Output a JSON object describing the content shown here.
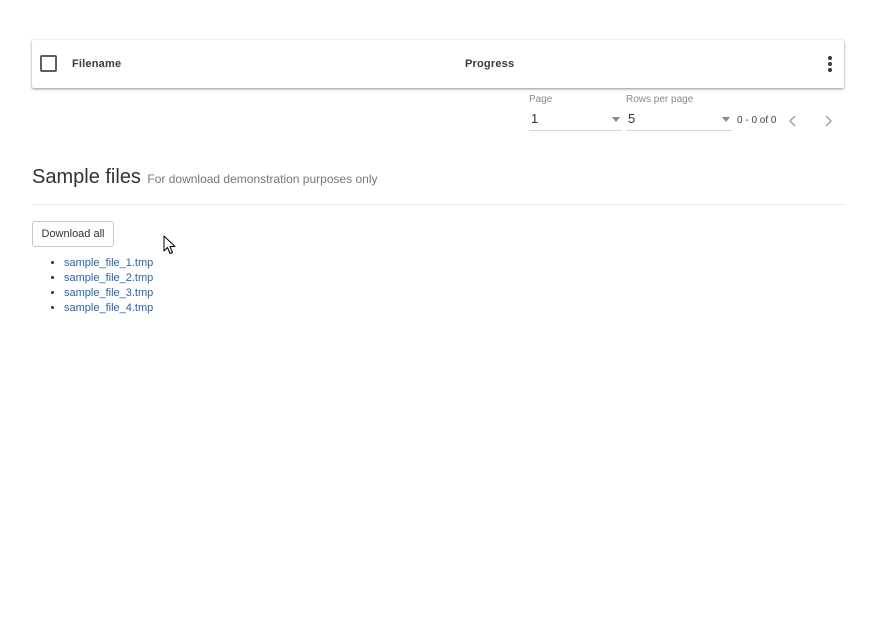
{
  "table": {
    "columns": [
      "Filename",
      "Progress"
    ],
    "select_all_checked": false,
    "rows": []
  },
  "pagination": {
    "page_label": "Page",
    "page_value": "1",
    "rows_label": "Rows per page",
    "rows_value": "5",
    "range_text": "0 - 0 of 0"
  },
  "section": {
    "title": "Sample files",
    "subtitle": "For download demonstration purposes only",
    "download_all_label": "Download all",
    "files": [
      "sample_file_1.tmp",
      "sample_file_2.tmp",
      "sample_file_3.tmp",
      "sample_file_4.tmp"
    ]
  },
  "colors": {
    "link": "#2a62a8",
    "text": "#333333",
    "muted": "#8a8a8a"
  },
  "icons": {
    "more": "more-vert-icon",
    "prev": "chevron-left-icon",
    "next": "chevron-right-icon",
    "caret": "caret-down-icon",
    "cursor": "mouse-pointer-icon"
  }
}
